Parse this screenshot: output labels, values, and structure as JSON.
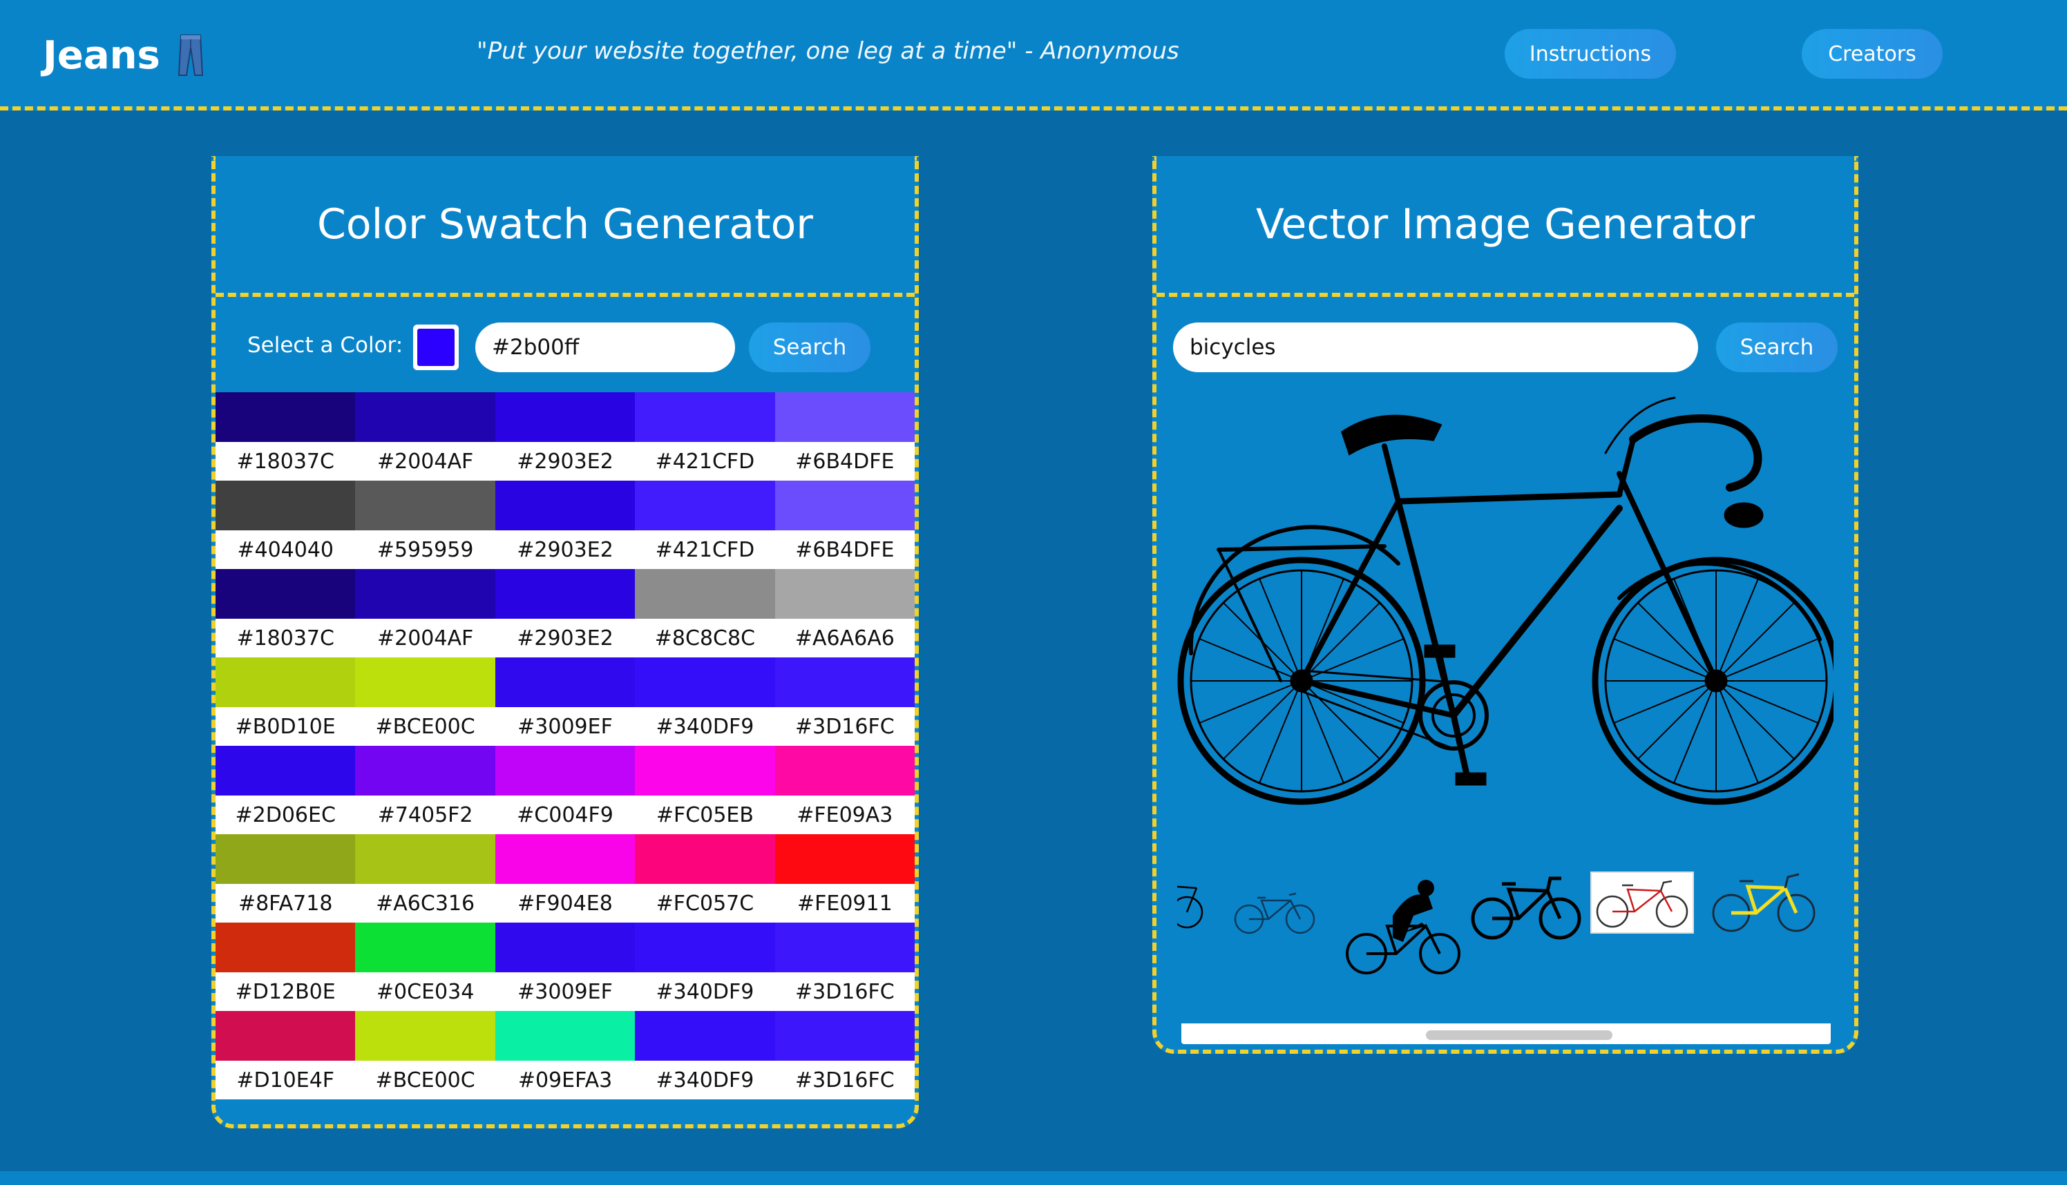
{
  "header": {
    "brand": "Jeans",
    "brand_icon": "jeans-icon",
    "quote": "\"Put your website together, one leg at a time\" - Anonymous",
    "nav": {
      "instructions": "Instructions",
      "creators": "Creators"
    }
  },
  "colors": {
    "accent_dashed": "#f2d22a",
    "panel_bg": "#0a84c9",
    "page_bg": "#0869a7"
  },
  "swatch_panel": {
    "title": "Color Swatch Generator",
    "select_label": "Select a Color:",
    "selected_color": "#2b00ff",
    "hex_value": "#2b00ff",
    "search_label": "Search",
    "rows": [
      [
        "#18037C",
        "#2004AF",
        "#2903E2",
        "#421CFD",
        "#6B4DFE"
      ],
      [
        "#404040",
        "#595959",
        "#2903E2",
        "#421CFD",
        "#6B4DFE"
      ],
      [
        "#18037C",
        "#2004AF",
        "#2903E2",
        "#8C8C8C",
        "#A6A6A6"
      ],
      [
        "#B0D10E",
        "#BCE00C",
        "#3009EF",
        "#340DF9",
        "#3D16FC"
      ],
      [
        "#2D06EC",
        "#7405F2",
        "#C004F9",
        "#FC05EB",
        "#FE09A3"
      ],
      [
        "#8FA718",
        "#A6C316",
        "#F904E8",
        "#FC057C",
        "#FE0911"
      ],
      [
        "#D12B0E",
        "#0CE034",
        "#3009EF",
        "#340DF9",
        "#3D16FC"
      ],
      [
        "#D10E4F",
        "#BCE00C",
        "#09EFA3",
        "#340DF9",
        "#3D16FC"
      ]
    ]
  },
  "vector_panel": {
    "title": "Vector Image Generator",
    "query": "bicycles",
    "search_label": "Search",
    "thumbnails": [
      "bicycle-thumb-1",
      "bicycle-thumb-2",
      "cyclist-thumb",
      "bicycle-thumb-4",
      "bicycle-thumb-5-selected",
      "bicycle-thumb-6"
    ]
  }
}
